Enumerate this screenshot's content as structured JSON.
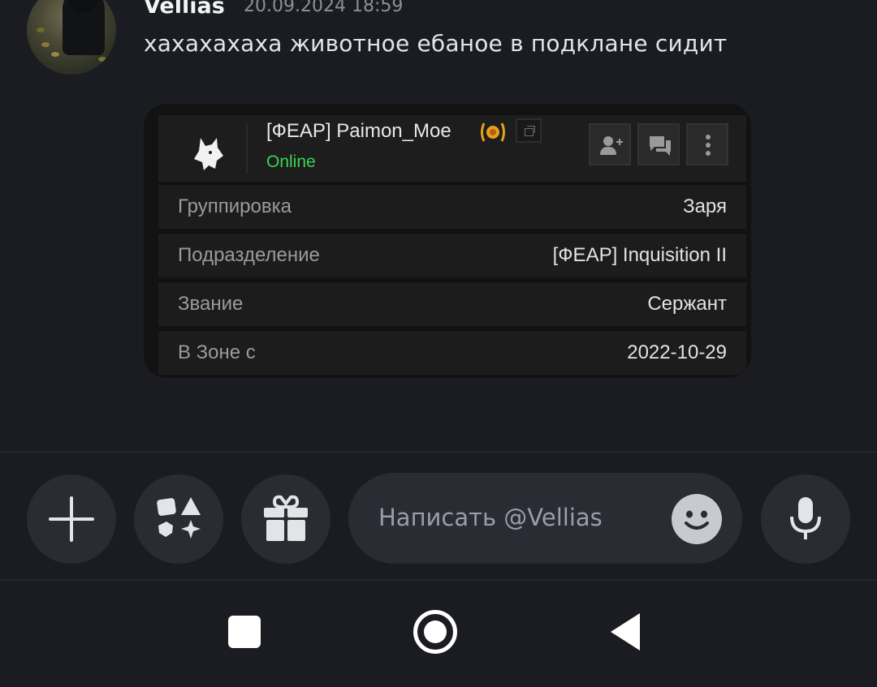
{
  "message": {
    "author": "Vellias",
    "timestamp": "20.09.2024 18:59",
    "text": "хахахахаха животное ебаное в подклане сидит"
  },
  "embed": {
    "player_name": "[ФЕАР] Paimon_Moe",
    "status": "Online",
    "status_color": "#3bd44f",
    "badge_color": "#e0a31a",
    "rows": [
      {
        "label": "Группировка",
        "value": "Заря"
      },
      {
        "label": "Подразделение",
        "value": "[ФЕАР] Inquisition II"
      },
      {
        "label": "Звание",
        "value": "Сержант"
      },
      {
        "label": "В Зоне с",
        "value": "2022-10-29"
      }
    ]
  },
  "composer": {
    "placeholder": "Написать @Vellias"
  }
}
